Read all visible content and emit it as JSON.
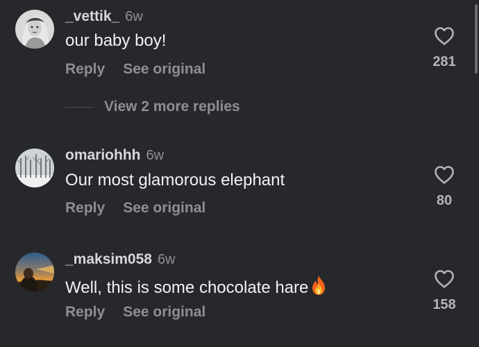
{
  "comments": [
    {
      "username": "_vettik_",
      "age": "6w",
      "text": "our baby boy!",
      "reply_label": "Reply",
      "see_original_label": "See original",
      "likes": "281"
    },
    {
      "username": "omariohhh",
      "age": "6w",
      "text": "Our most glamorous elephant",
      "reply_label": "Reply",
      "see_original_label": "See original",
      "likes": "80"
    },
    {
      "username": "_maksim058",
      "age": "6w",
      "text": "Well, this is some chocolate hare",
      "emoji": "fire-icon",
      "reply_label": "Reply",
      "see_original_label": "See original",
      "likes": "158"
    }
  ],
  "view_more_replies": "View 2 more replies",
  "colors": {
    "background": "#27282c",
    "text": "#f2f2f4",
    "secondary": "#8e8f96"
  }
}
